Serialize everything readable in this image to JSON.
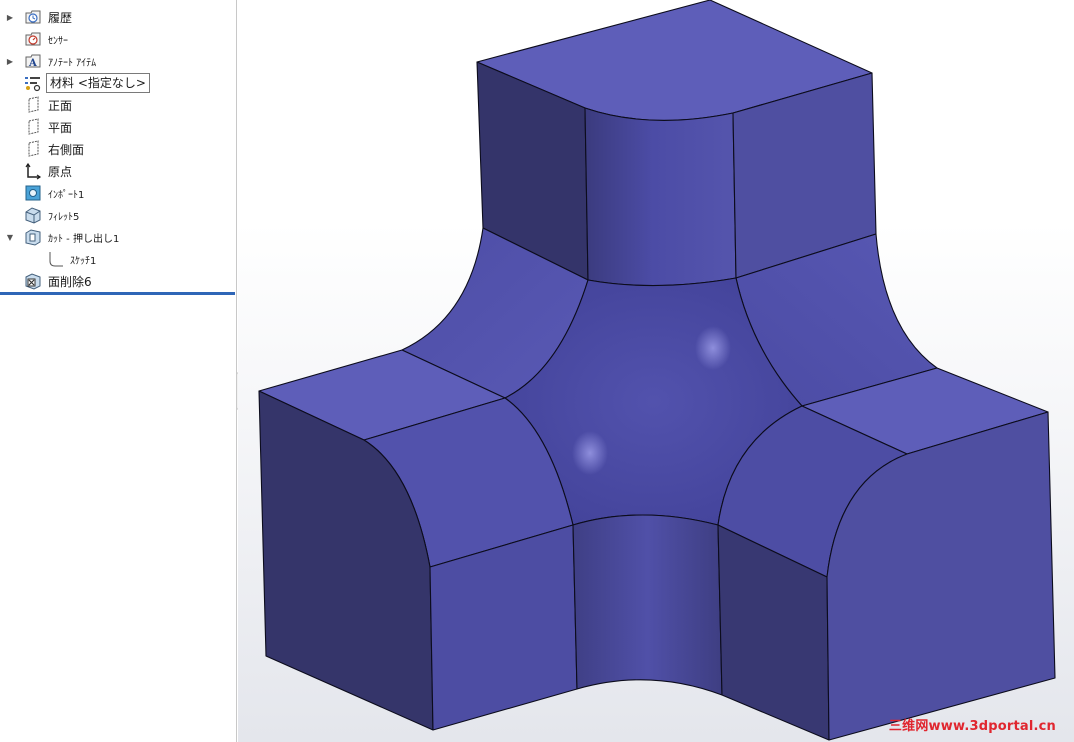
{
  "feature_tree": {
    "items": [
      {
        "label": "履歴",
        "icon": "history-icon",
        "expandable": true
      },
      {
        "label": "ｾﾝｻｰ",
        "icon": "sensor-icon",
        "expandable": false
      },
      {
        "label": "ｱﾉﾃｰﾄ ｱｲﾃﾑ",
        "icon": "annotation-icon",
        "expandable": true
      },
      {
        "label": "材料 <指定なし>",
        "icon": "material-icon",
        "expandable": false
      },
      {
        "label": "正面",
        "icon": "plane-icon",
        "expandable": false
      },
      {
        "label": "平面",
        "icon": "plane-icon",
        "expandable": false
      },
      {
        "label": "右側面",
        "icon": "plane-icon",
        "expandable": false
      },
      {
        "label": "原点",
        "icon": "origin-icon",
        "expandable": false
      },
      {
        "label": "ｲﾝﾎﾟｰﾄ1",
        "icon": "imported-body-icon",
        "expandable": false
      },
      {
        "label": "ﾌｨﾚｯﾄ5",
        "icon": "fillet-icon",
        "expandable": false
      },
      {
        "label": "ｶｯﾄ - 押し出し1",
        "icon": "cut-extrude-icon",
        "expandable": true,
        "expanded": true
      },
      {
        "label": "ｽｹｯﾁ1",
        "icon": "sketch-icon",
        "expandable": false
      },
      {
        "label": "面削除6",
        "icon": "delete-face-icon",
        "expandable": false
      }
    ]
  },
  "model": {
    "face_colors": {
      "top": "#5e5eb9",
      "mid": "#4f4fa2",
      "dark": "#363668",
      "curved": "#4848a0"
    },
    "edge_color": "#0c0c1c"
  },
  "watermark": "三维网www.3dportal.cn"
}
